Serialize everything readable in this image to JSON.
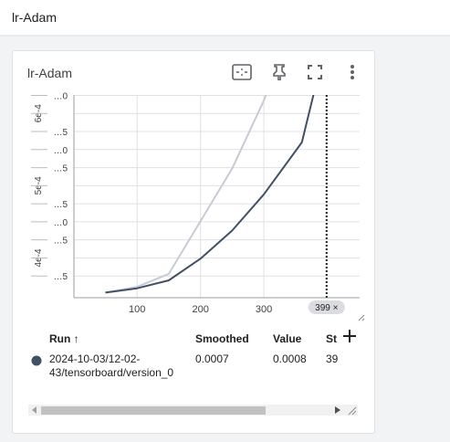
{
  "header": {
    "title": "lr-Adam"
  },
  "card": {
    "title": "lr-Adam",
    "tools": [
      {
        "name": "fit-domain-icon"
      },
      {
        "name": "pin-icon"
      },
      {
        "name": "fullscreen-icon"
      },
      {
        "name": "more-vert-icon"
      }
    ]
  },
  "colors": {
    "run": "#425066",
    "smoothed_shadow": "#c8cad4",
    "grid": "#e0e0e0"
  },
  "chart_data": {
    "type": "line",
    "title": "lr-Adam",
    "xlabel": "",
    "ylabel": "",
    "xlim": [
      0,
      450
    ],
    "ylim": [
      0.00035,
      0.000633
    ],
    "x_ticks": [
      {
        "v": 100,
        "label": "100"
      },
      {
        "v": 200,
        "label": "200"
      },
      {
        "v": 300,
        "label": "300"
      }
    ],
    "y_ticks": [
      {
        "v": 0.000375,
        "label": "…5",
        "rot_label": ""
      },
      {
        "v": 0.0004,
        "label": "",
        "rot_label": "4e-4"
      },
      {
        "v": 0.000425,
        "label": "…5",
        "rot_label": ""
      },
      {
        "v": 0.00045,
        "label": "…0",
        "rot_label": ""
      },
      {
        "v": 0.000475,
        "label": "…5",
        "rot_label": ""
      },
      {
        "v": 0.0005,
        "label": "",
        "rot_label": "5e-4"
      },
      {
        "v": 0.000525,
        "label": "…5",
        "rot_label": ""
      },
      {
        "v": 0.00055,
        "label": "…0",
        "rot_label": ""
      },
      {
        "v": 0.000575,
        "label": "…5",
        "rot_label": ""
      },
      {
        "v": 0.0006,
        "label": "",
        "rot_label": "6e-4"
      },
      {
        "v": 0.000625,
        "label": "…0",
        "rot_label": ""
      }
    ],
    "series": [
      {
        "role": "raw",
        "x": [
          50,
          100,
          150,
          200,
          250,
          300,
          350,
          360,
          399
        ],
        "y": [
          0.000352,
          0.00036,
          0.000378,
          0.000451,
          0.000524,
          0.000618,
          0.000728,
          0.00075,
          0.0008
        ]
      },
      {
        "role": "smoothed",
        "x": [
          50,
          100,
          150,
          200,
          250,
          300,
          350,
          360,
          399
        ],
        "y": [
          0.000352,
          0.000358,
          0.000369,
          0.000399,
          0.000438,
          0.000488,
          0.000548,
          0.00056,
          0.0007
        ]
      }
    ],
    "cursor_step": 399,
    "cursor_label": "399 ×",
    "grid": true
  },
  "table": {
    "headers": {
      "run": "Run ↑",
      "smoothed": "Smoothed",
      "value": "Value",
      "step": "St"
    },
    "rows": [
      {
        "run": "2024-10-03/12-02-43/tensorboard/version_0",
        "smoothed": "0.0007",
        "value": "0.0008",
        "step": "39"
      }
    ]
  }
}
